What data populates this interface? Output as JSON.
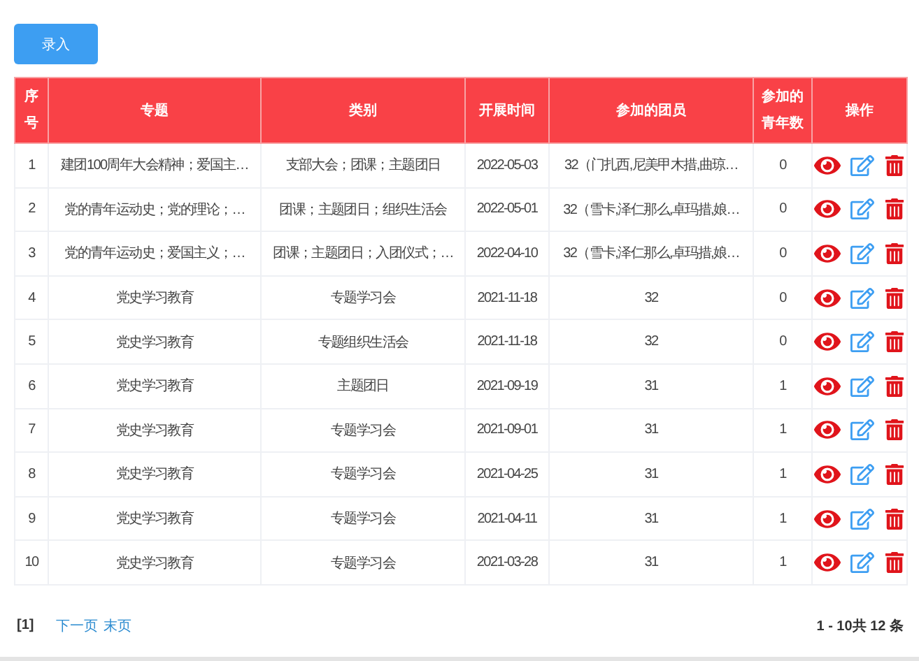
{
  "add_button": "录入",
  "table": {
    "columns": [
      "序号",
      "专题",
      "类别",
      "开展时间",
      "参加的团员",
      "参加的青年数",
      "操作"
    ],
    "rows": [
      {
        "cells": [
          "1",
          "建团100周年大会精神；爱国主…",
          "支部大会；团课；主题团日",
          "2022-05-03",
          "32（门扎西,尼美甲木措,曲琼…",
          "0"
        ]
      },
      {
        "cells": [
          "2",
          "党的青年运动史；党的理论；…",
          "团课；主题团日；组织生活会",
          "2022-05-01",
          "32（雪卡,泽仁那么,卓玛措,娘…",
          "0"
        ]
      },
      {
        "cells": [
          "3",
          "党的青年运动史；爱国主义；…",
          "团课；主题团日；入团仪式；…",
          "2022-04-10",
          "32（雪卡,泽仁那么,卓玛措,娘…",
          "0"
        ]
      },
      {
        "cells": [
          "4",
          "党史学习教育",
          "专题学习会",
          "2021-11-18",
          "32",
          "0"
        ]
      },
      {
        "cells": [
          "5",
          "党史学习教育",
          "专题组织生活会",
          "2021-11-18",
          "32",
          "0"
        ]
      },
      {
        "cells": [
          "6",
          "党史学习教育",
          "主题团日",
          "2021-09-19",
          "31",
          "1"
        ]
      },
      {
        "cells": [
          "7",
          "党史学习教育",
          "专题学习会",
          "2021-09-01",
          "31",
          "1"
        ]
      },
      {
        "cells": [
          "8",
          "党史学习教育",
          "专题学习会",
          "2021-04-25",
          "31",
          "1"
        ]
      },
      {
        "cells": [
          "9",
          "党史学习教育",
          "专题学习会",
          "2021-04-11",
          "31",
          "1"
        ]
      },
      {
        "cells": [
          "10",
          "党史学习教育",
          "专题学习会",
          "2021-03-28",
          "31",
          "1"
        ]
      }
    ]
  },
  "pagination": {
    "current": "[1]",
    "links": [
      "下一页",
      "末页"
    ],
    "summary": "1 - 10共 12 条"
  }
}
